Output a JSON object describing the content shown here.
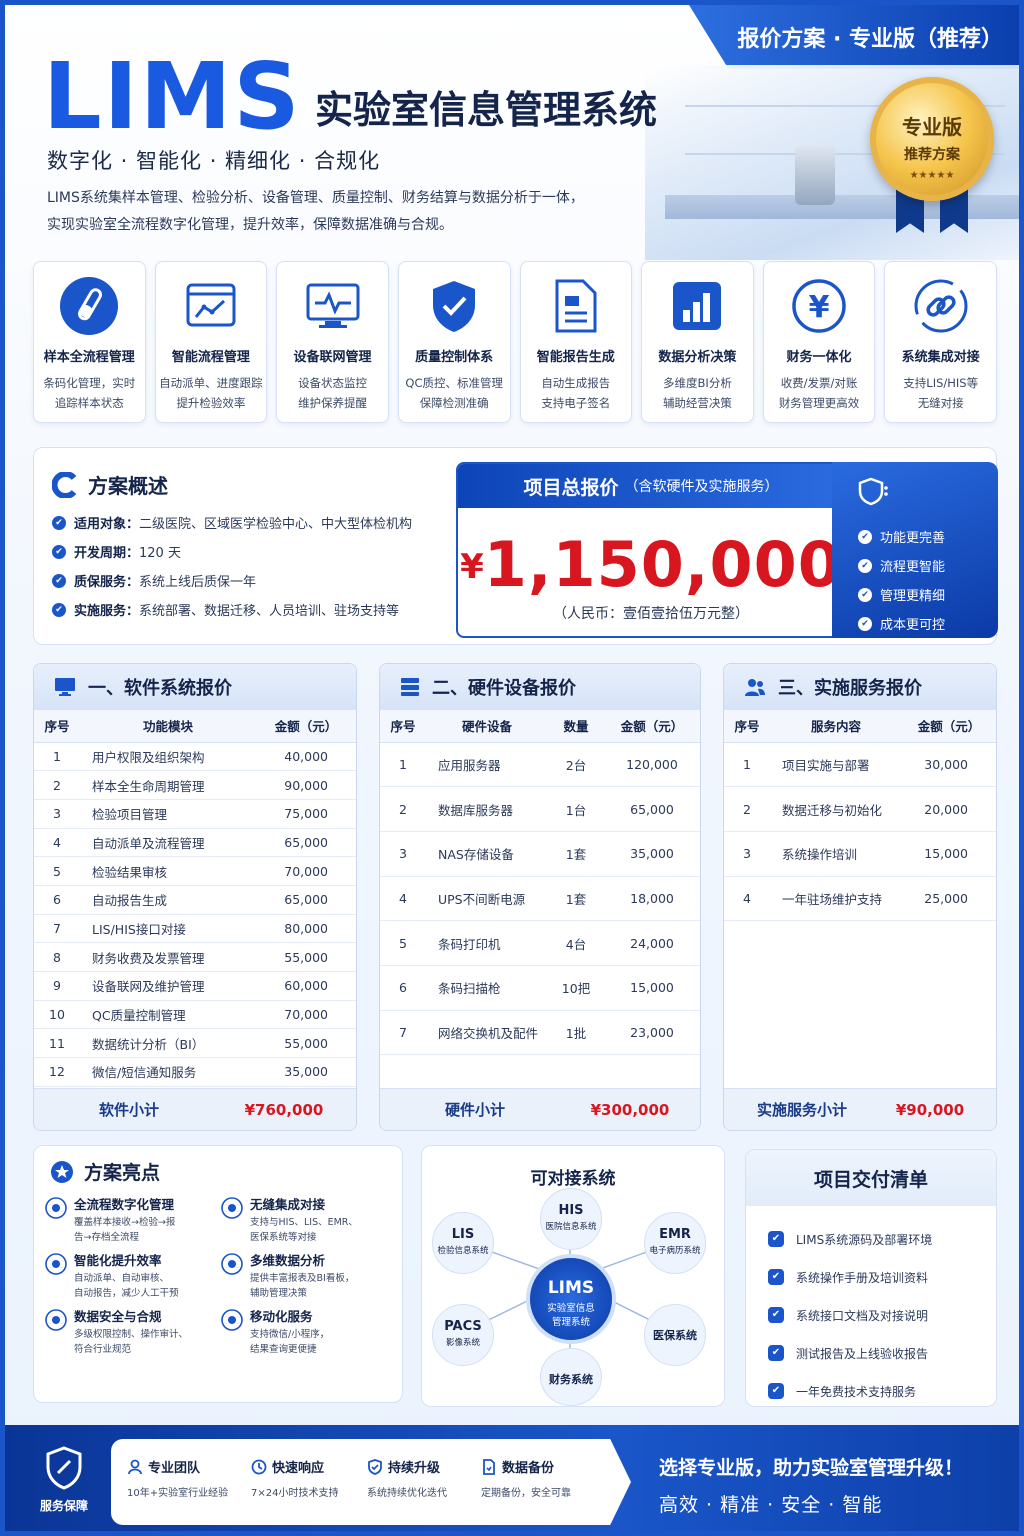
{
  "header": {
    "ribbon": "报价方案 · 专业版（推荐）",
    "logo": "LIMS",
    "title": "实验室信息管理系统",
    "tagline": "数字化 · 智能化 · 精细化 · 合规化",
    "description_1": "LIMS系统集样本管理、检验分析、设备管理、质量控制、财务结算与数据分析于一体，",
    "description_2": "实现实验室全流程数字化管理，提升效率，保障数据准确与合规。",
    "badge_line1": "专业版",
    "badge_line2": "推荐方案",
    "badge_stars": "★★★★★"
  },
  "features": [
    {
      "icon": "test-tube-icon",
      "title": "样本全流程管理",
      "d1": "条码化管理，实时",
      "d2": "追踪样本状态"
    },
    {
      "icon": "workflow-chart-icon",
      "title": "智能流程管理",
      "d1": "自动派单、进度跟踪",
      "d2": "提升检验效率"
    },
    {
      "icon": "monitor-pulse-icon",
      "title": "设备联网管理",
      "d1": "设备状态监控",
      "d2": "维护保养提醒"
    },
    {
      "icon": "shield-check-icon",
      "title": "质量控制体系",
      "d1": "QC质控、标准管理",
      "d2": "保障检测准确"
    },
    {
      "icon": "report-doc-icon",
      "title": "智能报告生成",
      "d1": "自动生成报告",
      "d2": "支持电子签名"
    },
    {
      "icon": "bar-chart-icon",
      "title": "数据分析决策",
      "d1": "多维度BI分析",
      "d2": "辅助经营决策"
    },
    {
      "icon": "yen-coin-icon",
      "title": "财务一体化",
      "d1": "收费/发票/对账",
      "d2": "财务管理更高效"
    },
    {
      "icon": "link-icon",
      "title": "系统集成对接",
      "d1": "支持LIS/HIS等",
      "d2": "无缝对接"
    }
  ],
  "overview": {
    "title": "方案概述",
    "items": [
      {
        "label": "适用对象：",
        "value": "二级医院、区域医学检验中心、中大型体检机构"
      },
      {
        "label": "开发周期：",
        "value": "120 天"
      },
      {
        "label": "质保服务：",
        "value": "系统上线后质保一年"
      },
      {
        "label": "实施服务：",
        "value": "系统部署、数据迁移、人员培训、驻场支持等"
      }
    ],
    "price_title": "项目总报价",
    "price_note": "（含软硬件及实施服务）",
    "currency": "¥",
    "price": "1,150,000",
    "price_cn": "（人民币：壹佰壹拾伍万元整）",
    "advantages": [
      "功能更完善",
      "流程更智能",
      "管理更精细",
      "成本更可控"
    ]
  },
  "software": {
    "title": "一、软件系统报价",
    "headers": [
      "序号",
      "功能模块",
      "金额（元）"
    ],
    "rows": [
      [
        "1",
        "用户权限及组织架构",
        "40,000"
      ],
      [
        "2",
        "样本全生命周期管理",
        "90,000"
      ],
      [
        "3",
        "检验项目管理",
        "75,000"
      ],
      [
        "4",
        "自动派单及流程管理",
        "65,000"
      ],
      [
        "5",
        "检验结果审核",
        "70,000"
      ],
      [
        "6",
        "自动报告生成",
        "65,000"
      ],
      [
        "7",
        "LIS/HIS接口对接",
        "80,000"
      ],
      [
        "8",
        "财务收费及发票管理",
        "55,000"
      ],
      [
        "9",
        "设备联网及维护管理",
        "60,000"
      ],
      [
        "10",
        "QC质量控制管理",
        "70,000"
      ],
      [
        "11",
        "数据统计分析（BI）",
        "55,000"
      ],
      [
        "12",
        "微信/短信通知服务",
        "35,000"
      ]
    ],
    "subtotal_label": "软件小计",
    "subtotal_value": "¥760,000"
  },
  "hardware": {
    "title": "二、硬件设备报价",
    "headers": [
      "序号",
      "硬件设备",
      "数量",
      "金额（元）"
    ],
    "rows": [
      [
        "1",
        "应用服务器",
        "2台",
        "120,000"
      ],
      [
        "2",
        "数据库服务器",
        "1台",
        "65,000"
      ],
      [
        "3",
        "NAS存储设备",
        "1套",
        "35,000"
      ],
      [
        "4",
        "UPS不间断电源",
        "1套",
        "18,000"
      ],
      [
        "5",
        "条码打印机",
        "4台",
        "24,000"
      ],
      [
        "6",
        "条码扫描枪",
        "10把",
        "15,000"
      ],
      [
        "7",
        "网络交换机及配件",
        "1批",
        "23,000"
      ]
    ],
    "subtotal_label": "硬件小计",
    "subtotal_value": "¥300,000"
  },
  "service": {
    "title": "三、实施服务报价",
    "headers": [
      "序号",
      "服务内容",
      "金额（元）"
    ],
    "rows": [
      [
        "1",
        "项目实施与部署",
        "30,000"
      ],
      [
        "2",
        "数据迁移与初始化",
        "20,000"
      ],
      [
        "3",
        "系统操作培训",
        "15,000"
      ],
      [
        "4",
        "一年驻场维护支持",
        "25,000"
      ]
    ],
    "subtotal_label": "实施服务小计",
    "subtotal_value": "¥90,000"
  },
  "highlights": {
    "title": "方案亮点",
    "items": [
      {
        "title": "全流程数字化管理",
        "d1": "覆盖样本接收→检验→报",
        "d2": "告→存档全流程"
      },
      {
        "title": "无缝集成对接",
        "d1": "支持与HIS、LIS、EMR、",
        "d2": "医保系统等对接"
      },
      {
        "title": "智能化提升效率",
        "d1": "自动派单、自动审核、",
        "d2": "自动报告，减少人工干预"
      },
      {
        "title": "多维数据分析",
        "d1": "提供丰富报表及BI看板，",
        "d2": "辅助管理决策"
      },
      {
        "title": "数据安全与合规",
        "d1": "多级权限控制、操作审计、",
        "d2": "符合行业规范"
      },
      {
        "title": "移动化服务",
        "d1": "支持微信/小程序，",
        "d2": "结果查询更便捷"
      }
    ]
  },
  "integration": {
    "title": "可对接系统",
    "center": {
      "name": "LIMS",
      "sub1": "实验室信息",
      "sub2": "管理系统"
    },
    "nodes": [
      {
        "name": "HIS",
        "sub": "医院信息系统"
      },
      {
        "name": "EMR",
        "sub": "电子病历系统"
      },
      {
        "name": "医保系统",
        "sub": ""
      },
      {
        "name": "财务系统",
        "sub": ""
      },
      {
        "name": "PACS",
        "sub": "影像系统"
      },
      {
        "name": "LIS",
        "sub": "检验信息系统"
      }
    ]
  },
  "delivery": {
    "title": "项目交付清单",
    "items": [
      "LIMS系统源码及部署环境",
      "系统操作手册及培训资料",
      "系统接口文档及对接说明",
      "测试报告及上线验收报告",
      "一年免费技术支持服务"
    ]
  },
  "footer": {
    "shield_label": "服务保障",
    "items": [
      {
        "title": "专业团队",
        "desc": "10年+实验室行业经验"
      },
      {
        "title": "快速响应",
        "desc": "7×24小时技术支持"
      },
      {
        "title": "持续升级",
        "desc": "系统持续优化迭代"
      },
      {
        "title": "数据备份",
        "desc": "定期备份，安全可靠"
      }
    ],
    "cta_1": "选择专业版，助力实验室管理升级！",
    "cta_2": "高效 · 精准 · 安全 · 智能"
  },
  "colors": {
    "brand": "#1a56c9",
    "price_red": "#d8161f",
    "dark_text": "#14244a"
  }
}
